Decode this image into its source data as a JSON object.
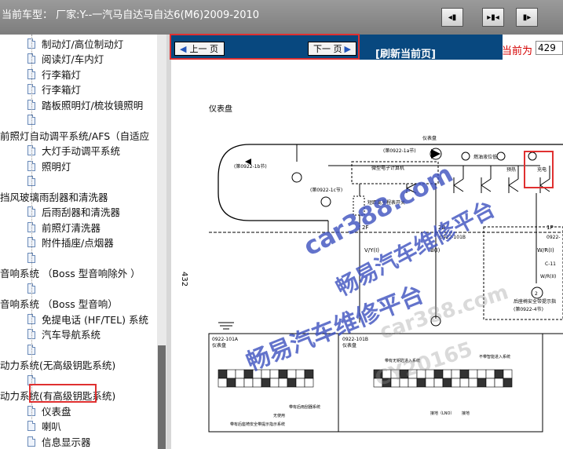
{
  "header": {
    "title": "当前车型：  厂家:Y--一汽马自达马自达6(M6)2009-2010",
    "toolbar_icons": [
      "collapse-left-icon",
      "split-view-icon",
      "collapse-right-icon"
    ]
  },
  "sidebar": {
    "items": [
      {
        "label": "制动灯/高位制动灯",
        "indent": 2
      },
      {
        "label": "阅读灯/车内灯",
        "indent": 2
      },
      {
        "label": "行李箱灯",
        "indent": 2
      },
      {
        "label": "行李箱灯",
        "indent": 2
      },
      {
        "label": "踏板照明灯/梳妆镜照明",
        "indent": 2
      },
      {
        "label": "",
        "indent": 2
      },
      {
        "label": "前照灯自动调平系统/AFS（自适应",
        "indent": 0
      },
      {
        "label": "大灯手动调平系统",
        "indent": 2
      },
      {
        "label": "照明灯",
        "indent": 2
      },
      {
        "label": "",
        "indent": 2
      },
      {
        "label": "挡风玻璃雨刮器和清洗器",
        "indent": 0
      },
      {
        "label": "后雨刮器和清洗器",
        "indent": 2
      },
      {
        "label": "前照灯清洗器",
        "indent": 2
      },
      {
        "label": "附件插座/点烟器",
        "indent": 2
      },
      {
        "label": "",
        "indent": 2
      },
      {
        "label": "音响系统   （Boss 型音响除外 ）",
        "indent": 0
      },
      {
        "label": "",
        "indent": 2
      },
      {
        "label": "音响系统   （Boss 型音响）",
        "indent": 0
      },
      {
        "label": "免提电话 (HF/TEL) 系统",
        "indent": 2
      },
      {
        "label": "汽车导航系统",
        "indent": 2
      },
      {
        "label": "",
        "indent": 2
      },
      {
        "label": "动力系统(无高级钥匙系统)",
        "indent": 0
      },
      {
        "label": "",
        "indent": 2
      },
      {
        "label": "动力系统(有高级钥匙系统)",
        "indent": 0
      },
      {
        "label": "仪表盘",
        "indent": 2,
        "selected": true
      },
      {
        "label": "喇叭",
        "indent": 2
      },
      {
        "label": "信息显示器",
        "indent": 2
      }
    ]
  },
  "nav": {
    "prev_label": "上一 页",
    "next_label": "下一 页",
    "refresh_label": "[刷新当前页]",
    "current_label": "当前为",
    "current_value": "429"
  },
  "diagram": {
    "title": "仪表盘",
    "page_number": "432",
    "top_label": "仪表盘",
    "ref_1a": "(第0922-1a节)",
    "ref_1b": "(第0922-1b节)",
    "ref_1c": "(第0922-1c节)",
    "micro_label": "微型电子计算机",
    "fuel_label": "燃油液位低",
    "preheat_label": "预热",
    "charge_label": "充电",
    "odo_label": "短距离里程表开关",
    "pin_2f": "2F",
    "pin_2b": "2B",
    "pin_1p": "1P",
    "conn_101b": "0922-101B",
    "conn_101b_right": "0922-",
    "wire_vy": "V/Y(I)",
    "wire_b": "B(I)",
    "wire_wr": "W/R(I)",
    "wire_wr2": "W/R(II)",
    "c11": "C-11",
    "pin_2": "2",
    "rear_label": "后座椅安全带提示指",
    "sec_4": "(第0922-4节)",
    "conn_a_code": "0922-101A",
    "conn_a_name": "仪表盘",
    "conn_b_code": "0922-101B",
    "conn_b_name": "仪表盘",
    "legend_1": "带有无钥匙进入系统",
    "legend_2": "不带智能进入系统",
    "legend_3": "带有后雨刮器系统",
    "legend_4": "无使用",
    "legend_5": "带有后座椅安全带提示指示系统",
    "ground_label": "接地（LNO）",
    "ground_num": "接地"
  },
  "watermarks": {
    "wm1": "car388.com",
    "wm2": "畅易汽车维修平台",
    "wm3": "畅易汽车维修平台",
    "wm4": "car388.com",
    "wm5": "CY20165"
  }
}
